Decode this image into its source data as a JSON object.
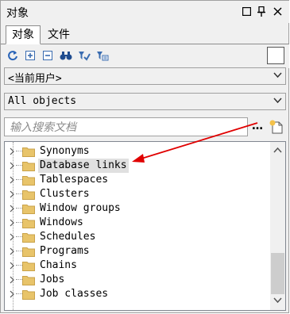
{
  "window": {
    "title": "对象"
  },
  "tabs": [
    {
      "label": "对象"
    },
    {
      "label": "文件"
    }
  ],
  "toolbar": {
    "icons": [
      "refresh-icon",
      "expand-icon",
      "collapse-icon",
      "find-icon",
      "filter-icon",
      "filter-edit-icon"
    ]
  },
  "user_select": {
    "value": "<当前用户>"
  },
  "object_select": {
    "value": "All objects"
  },
  "search": {
    "placeholder": "输入搜索文档",
    "value": ""
  },
  "tree": {
    "items": [
      {
        "label": "Synonyms"
      },
      {
        "label": "Database links"
      },
      {
        "label": "Tablespaces"
      },
      {
        "label": "Clusters"
      },
      {
        "label": "Window groups"
      },
      {
        "label": "Windows"
      },
      {
        "label": "Schedules"
      },
      {
        "label": "Programs"
      },
      {
        "label": "Chains"
      },
      {
        "label": "Jobs"
      },
      {
        "label": "Job classes"
      }
    ],
    "selected_index": 1
  },
  "colors": {
    "annotation_arrow": "#e00000",
    "folder": "#e8c46a"
  }
}
